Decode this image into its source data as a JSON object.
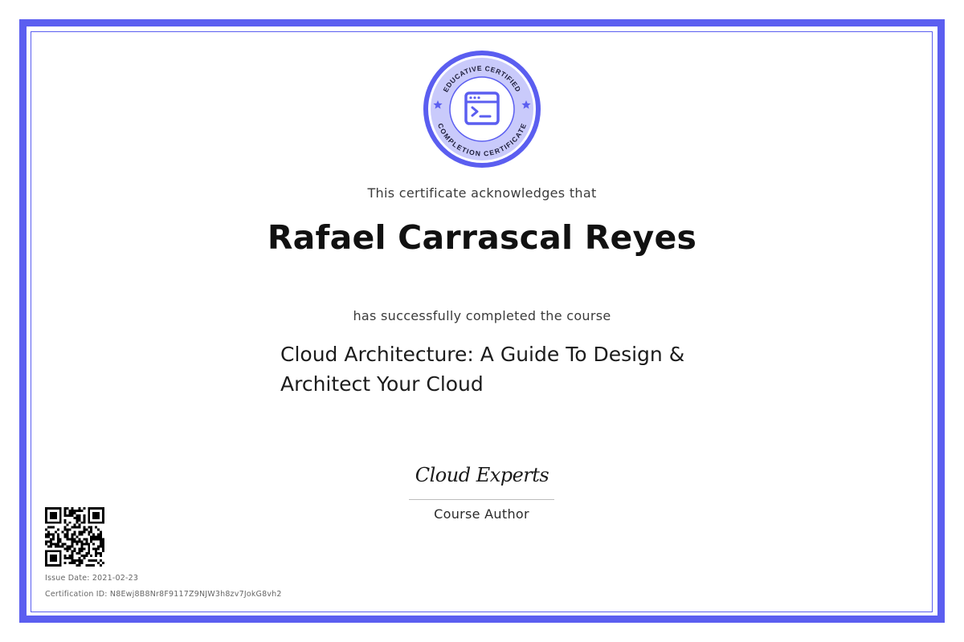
{
  "certificate": {
    "intro": "This certificate acknowledges that",
    "recipient": "Rafael Carrascal Reyes",
    "completed_text": "has successfully completed the course",
    "course_line1": "Cloud Architecture: A Guide To Design &",
    "course_line2": "Architect Your Cloud",
    "signature": "Cloud Experts",
    "author_label": "Course Author",
    "issue_date": "Issue Date: 2021-02-23",
    "certification_id": "Certification ID: N8Ewj8B8Nr8F9117Z9NJW3h8zv7JokG8vh2"
  },
  "badge": {
    "top_text": "EDUCATIVE CERTIFIED",
    "bottom_text": "COMPLETION CERTIFICATE",
    "icon": "terminal-window-icon"
  },
  "colors": {
    "accent": "#5b5ef0",
    "accent_light": "#c9cafb",
    "text_dark": "#111111",
    "text_muted": "#666666"
  }
}
